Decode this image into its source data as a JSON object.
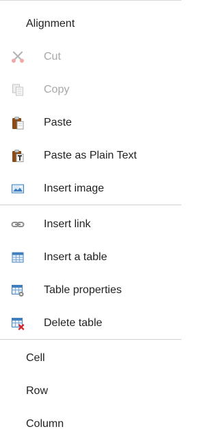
{
  "menu": {
    "items": [
      {
        "label": "Alignment"
      },
      {
        "label": "Cut",
        "icon": "cut-icon",
        "disabled": true
      },
      {
        "label": "Copy",
        "icon": "copy-icon",
        "disabled": true
      },
      {
        "label": "Paste",
        "icon": "paste-icon"
      },
      {
        "label": "Paste as Plain Text",
        "icon": "paste-plain-text-icon"
      },
      {
        "label": "Insert image",
        "icon": "insert-image-icon"
      },
      {
        "label": "Insert link",
        "icon": "insert-link-icon"
      },
      {
        "label": "Insert a table",
        "icon": "insert-table-icon"
      },
      {
        "label": "Table properties",
        "icon": "table-properties-icon"
      },
      {
        "label": "Delete table",
        "icon": "delete-table-icon"
      },
      {
        "label": "Cell"
      },
      {
        "label": "Row"
      },
      {
        "label": "Column"
      }
    ]
  },
  "colors": {
    "text": "#222222",
    "disabled_text": "#a7a7a7",
    "separator": "#d0d0d0",
    "table_blue": "#3f7fbf",
    "delete_red": "#d9242b",
    "clipboard_brown": "#8a4b16"
  }
}
